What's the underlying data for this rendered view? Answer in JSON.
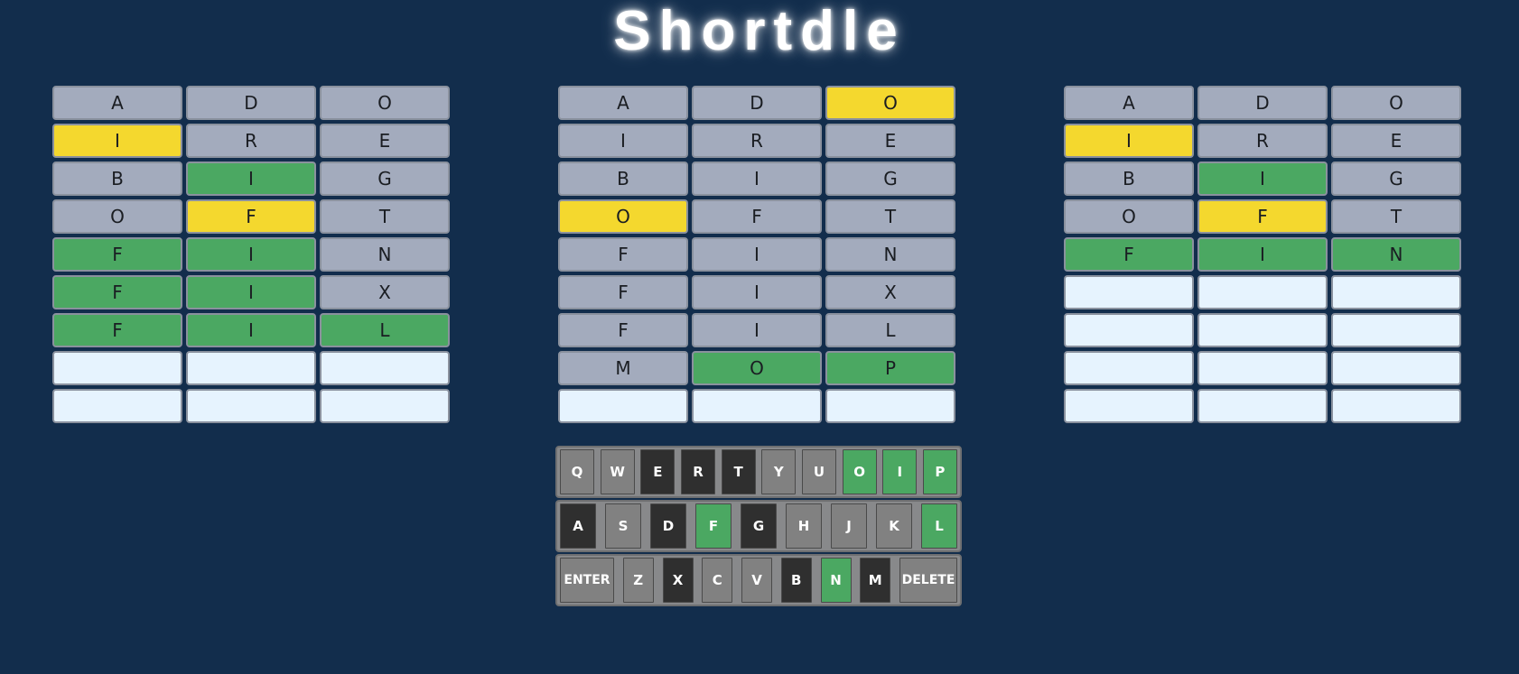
{
  "title": "Shortdle",
  "colors": {
    "background": "#122d4c",
    "tile_absent": "#a3abbd",
    "tile_present": "#f4d82e",
    "tile_correct": "#4ba862",
    "tile_empty": "#e6f3fe",
    "key_unused": "#818181",
    "key_absent": "#2f2f2f",
    "key_correct": "#4ba862"
  },
  "boards": [
    {
      "id": "left",
      "rows": [
        [
          {
            "letter": "A",
            "state": "absent"
          },
          {
            "letter": "D",
            "state": "absent"
          },
          {
            "letter": "O",
            "state": "absent"
          }
        ],
        [
          {
            "letter": "I",
            "state": "present"
          },
          {
            "letter": "R",
            "state": "absent"
          },
          {
            "letter": "E",
            "state": "absent"
          }
        ],
        [
          {
            "letter": "B",
            "state": "absent"
          },
          {
            "letter": "I",
            "state": "correct"
          },
          {
            "letter": "G",
            "state": "absent"
          }
        ],
        [
          {
            "letter": "O",
            "state": "absent"
          },
          {
            "letter": "F",
            "state": "present"
          },
          {
            "letter": "T",
            "state": "absent"
          }
        ],
        [
          {
            "letter": "F",
            "state": "correct"
          },
          {
            "letter": "I",
            "state": "correct"
          },
          {
            "letter": "N",
            "state": "absent"
          }
        ],
        [
          {
            "letter": "F",
            "state": "correct"
          },
          {
            "letter": "I",
            "state": "correct"
          },
          {
            "letter": "X",
            "state": "absent"
          }
        ],
        [
          {
            "letter": "F",
            "state": "correct"
          },
          {
            "letter": "I",
            "state": "correct"
          },
          {
            "letter": "L",
            "state": "correct"
          }
        ],
        [
          {
            "letter": "",
            "state": "empty"
          },
          {
            "letter": "",
            "state": "empty"
          },
          {
            "letter": "",
            "state": "empty"
          }
        ],
        [
          {
            "letter": "",
            "state": "empty"
          },
          {
            "letter": "",
            "state": "empty"
          },
          {
            "letter": "",
            "state": "empty"
          }
        ]
      ]
    },
    {
      "id": "center",
      "rows": [
        [
          {
            "letter": "A",
            "state": "absent"
          },
          {
            "letter": "D",
            "state": "absent"
          },
          {
            "letter": "O",
            "state": "present"
          }
        ],
        [
          {
            "letter": "I",
            "state": "absent"
          },
          {
            "letter": "R",
            "state": "absent"
          },
          {
            "letter": "E",
            "state": "absent"
          }
        ],
        [
          {
            "letter": "B",
            "state": "absent"
          },
          {
            "letter": "I",
            "state": "absent"
          },
          {
            "letter": "G",
            "state": "absent"
          }
        ],
        [
          {
            "letter": "O",
            "state": "present"
          },
          {
            "letter": "F",
            "state": "absent"
          },
          {
            "letter": "T",
            "state": "absent"
          }
        ],
        [
          {
            "letter": "F",
            "state": "absent"
          },
          {
            "letter": "I",
            "state": "absent"
          },
          {
            "letter": "N",
            "state": "absent"
          }
        ],
        [
          {
            "letter": "F",
            "state": "absent"
          },
          {
            "letter": "I",
            "state": "absent"
          },
          {
            "letter": "X",
            "state": "absent"
          }
        ],
        [
          {
            "letter": "F",
            "state": "absent"
          },
          {
            "letter": "I",
            "state": "absent"
          },
          {
            "letter": "L",
            "state": "absent"
          }
        ],
        [
          {
            "letter": "M",
            "state": "absent"
          },
          {
            "letter": "O",
            "state": "correct"
          },
          {
            "letter": "P",
            "state": "correct"
          }
        ],
        [
          {
            "letter": "",
            "state": "empty"
          },
          {
            "letter": "",
            "state": "empty"
          },
          {
            "letter": "",
            "state": "empty"
          }
        ]
      ]
    },
    {
      "id": "right",
      "rows": [
        [
          {
            "letter": "A",
            "state": "absent"
          },
          {
            "letter": "D",
            "state": "absent"
          },
          {
            "letter": "O",
            "state": "absent"
          }
        ],
        [
          {
            "letter": "I",
            "state": "present"
          },
          {
            "letter": "R",
            "state": "absent"
          },
          {
            "letter": "E",
            "state": "absent"
          }
        ],
        [
          {
            "letter": "B",
            "state": "absent"
          },
          {
            "letter": "I",
            "state": "correct"
          },
          {
            "letter": "G",
            "state": "absent"
          }
        ],
        [
          {
            "letter": "O",
            "state": "absent"
          },
          {
            "letter": "F",
            "state": "present"
          },
          {
            "letter": "T",
            "state": "absent"
          }
        ],
        [
          {
            "letter": "F",
            "state": "correct"
          },
          {
            "letter": "I",
            "state": "correct"
          },
          {
            "letter": "N",
            "state": "correct"
          }
        ],
        [
          {
            "letter": "",
            "state": "empty"
          },
          {
            "letter": "",
            "state": "empty"
          },
          {
            "letter": "",
            "state": "empty"
          }
        ],
        [
          {
            "letter": "",
            "state": "empty"
          },
          {
            "letter": "",
            "state": "empty"
          },
          {
            "letter": "",
            "state": "empty"
          }
        ],
        [
          {
            "letter": "",
            "state": "empty"
          },
          {
            "letter": "",
            "state": "empty"
          },
          {
            "letter": "",
            "state": "empty"
          }
        ],
        [
          {
            "letter": "",
            "state": "empty"
          },
          {
            "letter": "",
            "state": "empty"
          },
          {
            "letter": "",
            "state": "empty"
          }
        ]
      ]
    }
  ],
  "keyboard": {
    "rows": [
      [
        {
          "label": "Q",
          "state": "unused"
        },
        {
          "label": "W",
          "state": "unused"
        },
        {
          "label": "E",
          "state": "absent"
        },
        {
          "label": "R",
          "state": "absent"
        },
        {
          "label": "T",
          "state": "absent"
        },
        {
          "label": "Y",
          "state": "unused"
        },
        {
          "label": "U",
          "state": "unused"
        },
        {
          "label": "O",
          "state": "correct"
        },
        {
          "label": "I",
          "state": "correct"
        },
        {
          "label": "P",
          "state": "correct"
        }
      ],
      [
        {
          "label": "A",
          "state": "absent"
        },
        {
          "label": "S",
          "state": "unused"
        },
        {
          "label": "D",
          "state": "absent"
        },
        {
          "label": "F",
          "state": "correct"
        },
        {
          "label": "G",
          "state": "absent"
        },
        {
          "label": "H",
          "state": "unused"
        },
        {
          "label": "J",
          "state": "unused"
        },
        {
          "label": "K",
          "state": "unused"
        },
        {
          "label": "L",
          "state": "correct"
        }
      ],
      [
        {
          "label": "ENTER",
          "state": "unused",
          "wide": true
        },
        {
          "label": "Z",
          "state": "unused"
        },
        {
          "label": "X",
          "state": "absent"
        },
        {
          "label": "C",
          "state": "unused"
        },
        {
          "label": "V",
          "state": "unused"
        },
        {
          "label": "B",
          "state": "absent"
        },
        {
          "label": "N",
          "state": "correct"
        },
        {
          "label": "M",
          "state": "absent"
        },
        {
          "label": "DELETE",
          "state": "unused",
          "wide": true
        }
      ]
    ]
  }
}
